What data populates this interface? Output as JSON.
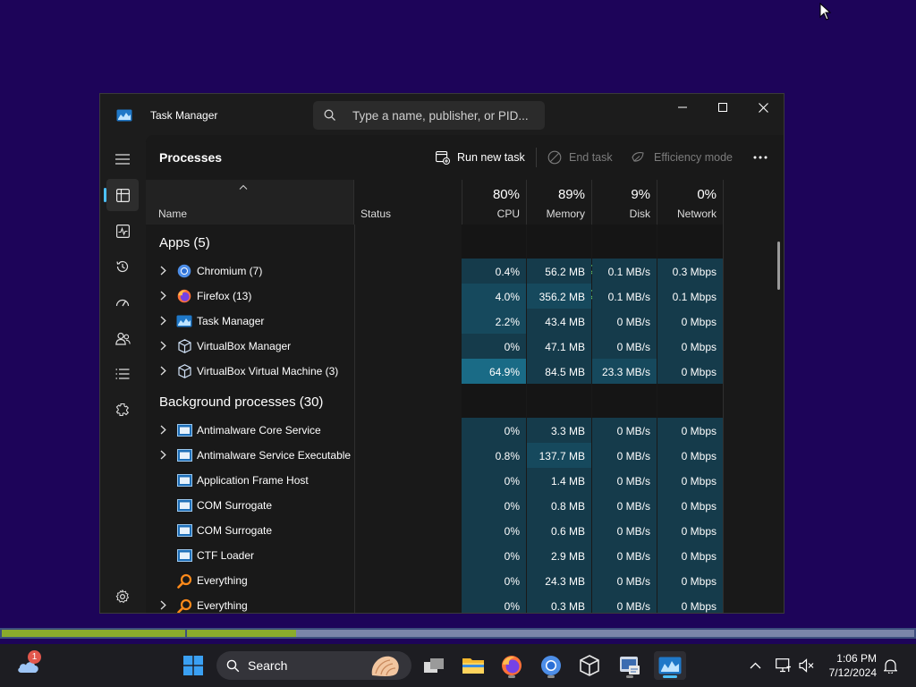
{
  "window": {
    "title": "Task Manager",
    "search_placeholder": "Type a name, publisher, or PID...",
    "controls": [
      "minimize-icon",
      "maximize-icon",
      "close-icon"
    ]
  },
  "sidebar": {
    "items": [
      {
        "name": "menu",
        "icon": "hamburger-icon"
      },
      {
        "name": "processes",
        "icon": "processes-icon",
        "active": true
      },
      {
        "name": "performance",
        "icon": "performance-icon"
      },
      {
        "name": "app-history",
        "icon": "history-icon"
      },
      {
        "name": "startup-apps",
        "icon": "speedometer-icon"
      },
      {
        "name": "users",
        "icon": "users-icon"
      },
      {
        "name": "details",
        "icon": "details-icon"
      },
      {
        "name": "services",
        "icon": "services-icon"
      },
      {
        "name": "settings",
        "icon": "settings-icon"
      }
    ]
  },
  "toolbar": {
    "page_title": "Processes",
    "run_new_task": "Run new task",
    "end_task": "End task",
    "efficiency_mode": "Efficiency mode",
    "more": "more-icon"
  },
  "columns": {
    "name": "Name",
    "status": "Status",
    "cpu": {
      "percent": "80%",
      "label": "CPU"
    },
    "memory": {
      "percent": "89%",
      "label": "Memory"
    },
    "disk": {
      "percent": "9%",
      "label": "Disk"
    },
    "network": {
      "percent": "0%",
      "label": "Network"
    }
  },
  "groups": {
    "apps": "Apps (5)",
    "background": "Background processes (30)"
  },
  "apps": [
    {
      "name": "Chromium (7)",
      "icon": "chromium-icon",
      "expandable": true,
      "efficiency": true,
      "cpu": "0.4%",
      "memory": "56.2 MB",
      "disk": "0.1 MB/s",
      "network": "0.3 Mbps"
    },
    {
      "name": "Firefox (13)",
      "icon": "firefox-icon",
      "expandable": true,
      "efficiency": true,
      "cpu": "4.0%",
      "memory": "356.2 MB",
      "disk": "0.1 MB/s",
      "network": "0.1 Mbps"
    },
    {
      "name": "Task Manager",
      "icon": "task-manager-icon",
      "expandable": true,
      "efficiency": false,
      "cpu": "2.2%",
      "memory": "43.4 MB",
      "disk": "0 MB/s",
      "network": "0 Mbps"
    },
    {
      "name": "VirtualBox Manager",
      "icon": "virtualbox-icon",
      "expandable": true,
      "efficiency": false,
      "cpu": "0%",
      "memory": "47.1 MB",
      "disk": "0 MB/s",
      "network": "0 Mbps"
    },
    {
      "name": "VirtualBox Virtual Machine (3)",
      "icon": "virtualbox-icon",
      "expandable": true,
      "efficiency": false,
      "cpu": "64.9%",
      "memory": "84.5 MB",
      "disk": "23.3 MB/s",
      "network": "0 Mbps"
    }
  ],
  "background": [
    {
      "name": "Antimalware Core Service",
      "icon": "service-window-icon",
      "expandable": true,
      "cpu": "0%",
      "memory": "3.3 MB",
      "disk": "0 MB/s",
      "network": "0 Mbps"
    },
    {
      "name": "Antimalware Service Executable",
      "icon": "service-window-icon",
      "expandable": true,
      "cpu": "0.8%",
      "memory": "137.7 MB",
      "disk": "0 MB/s",
      "network": "0 Mbps"
    },
    {
      "name": "Application Frame Host",
      "icon": "service-window-icon",
      "expandable": false,
      "cpu": "0%",
      "memory": "1.4 MB",
      "disk": "0 MB/s",
      "network": "0 Mbps"
    },
    {
      "name": "COM Surrogate",
      "icon": "service-window-icon",
      "expandable": false,
      "cpu": "0%",
      "memory": "0.8 MB",
      "disk": "0 MB/s",
      "network": "0 Mbps"
    },
    {
      "name": "COM Surrogate",
      "icon": "service-window-icon",
      "expandable": false,
      "cpu": "0%",
      "memory": "0.6 MB",
      "disk": "0 MB/s",
      "network": "0 Mbps"
    },
    {
      "name": "CTF Loader",
      "icon": "service-window-icon",
      "expandable": false,
      "cpu": "0%",
      "memory": "2.9 MB",
      "disk": "0 MB/s",
      "network": "0 Mbps"
    },
    {
      "name": "Everything",
      "icon": "everything-search-icon",
      "expandable": false,
      "cpu": "0%",
      "memory": "24.3 MB",
      "disk": "0 MB/s",
      "network": "0 Mbps"
    },
    {
      "name": "Everything",
      "icon": "everything-search-icon",
      "expandable": true,
      "cpu": "0%",
      "memory": "0.3 MB",
      "disk": "0 MB/s",
      "network": "0 Mbps"
    }
  ],
  "taskbar": {
    "search_label": "Search",
    "weather_badge": "1",
    "apps": [
      "windows-start-icon",
      "task-view-icon",
      "file-explorer-icon",
      "firefox-icon",
      "chromium-icon",
      "virtualbox-icon",
      "virtualbox-vm-icon",
      "task-manager-icon"
    ],
    "tray": [
      "chevron-up-icon",
      "network-icon",
      "volume-muted-icon",
      "notification-bell-icon"
    ],
    "time": "1:06 PM",
    "date": "7/12/2024"
  },
  "progress": {
    "segment2_fraction": 0.15
  },
  "colors": {
    "desktop": "#1d0459",
    "window_bg": "#1c1c1c",
    "accent": "#4cc2ff",
    "heat_low": "#153b4b",
    "heat_mid": "#16495d",
    "heat_high": "#1a6b86",
    "efficiency_leaf": "#6ccb5f"
  }
}
